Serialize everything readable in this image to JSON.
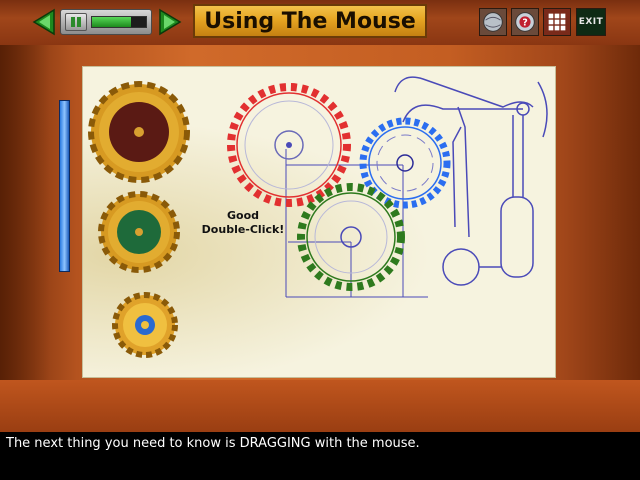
{
  "toolbar": {
    "title": "Using The Mouse",
    "progress_fraction": 0.72,
    "exit_label": "EXIT",
    "icons": [
      "back-arrow-icon",
      "pause-icon",
      "forward-arrow-icon",
      "globe-icon",
      "help-icon",
      "grid-icon"
    ],
    "colors": {
      "title_plate": "#e6a522",
      "arrow": "#1e8a1e",
      "exit_bg": "#0e2a14"
    }
  },
  "board": {
    "feedback_line1": "Good",
    "feedback_line2": "Double-Click!",
    "gear_colors": {
      "red": "#e23030",
      "blue": "#2b6ef0",
      "green": "#2e7a1e"
    }
  },
  "caption": {
    "text": "The next thing you need to know is DRAGGING with the mouse."
  }
}
